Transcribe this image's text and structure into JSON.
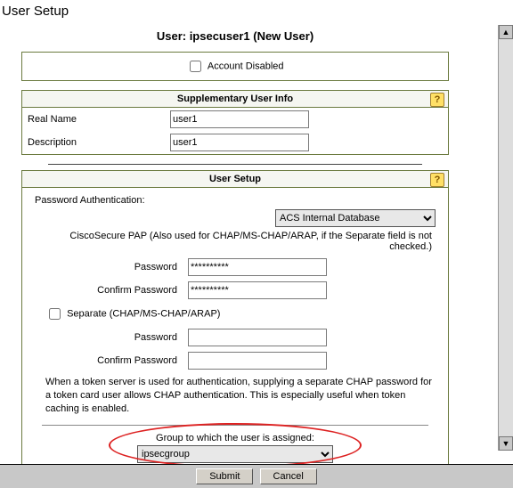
{
  "page_title": "User Setup",
  "user_header": "User: ipsecuser1 (New User)",
  "account_disabled": {
    "label": "Account Disabled",
    "checked": false
  },
  "suppl": {
    "title": "Supplementary User Info",
    "real_name_label": "Real Name",
    "real_name_value": "user1",
    "description_label": "Description",
    "description_value": "user1"
  },
  "usetup": {
    "title": "User Setup",
    "pw_auth_label": "Password Authentication:",
    "auth_db_selected": "ACS Internal Database",
    "pap_note": "CiscoSecure PAP (Also used for CHAP/MS-CHAP/ARAP, if the Separate field is not checked.)",
    "password_label": "Password",
    "confirm_password_label": "Confirm Password",
    "password_value": "**********",
    "confirm_password_value": "**********",
    "separate_label": "Separate (CHAP/MS-CHAP/ARAP)",
    "separate_checked": false,
    "sep_password_label": "Password",
    "sep_confirm_label": "Confirm Password",
    "token_note": "When a token server is used for authentication, supplying a separate CHAP password for a token card user allows CHAP authentication. This is especially useful when token caching is enabled.",
    "group_label": "Group to which the user is assigned:",
    "group_selected": "ipsecgroup"
  },
  "buttons": {
    "submit": "Submit",
    "cancel": "Cancel"
  },
  "glyphs": {
    "help": "?",
    "up": "▲",
    "down": "▼"
  }
}
